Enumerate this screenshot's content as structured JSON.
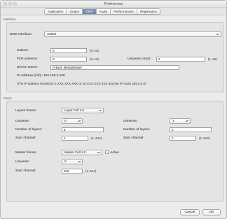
{
  "window": {
    "title": "Preferences"
  },
  "tabs": [
    {
      "label": "Application"
    },
    {
      "label": "Output"
    },
    {
      "label": "DMX",
      "active": true
    },
    {
      "label": "Audio"
    },
    {
      "label": "Performances"
    },
    {
      "label": "Registration"
    }
  ],
  "interface": {
    "section_label": "Interface",
    "dmx_interface_label": "DMX Interface:",
    "dmx_interface_value": "ArtNet",
    "subnet_label": "Subnet:",
    "subnet_value": "0",
    "subnet_range": "(0–15)",
    "first_universe_label": "First universe:",
    "first_universe_value": "0",
    "first_universe_range": "(0–15)",
    "universe_count_label": "Universe count:",
    "universe_count_value": "2",
    "universe_count_range": "(1–16)",
    "device_name_label": "Device Name:",
    "device_name_value": "Arkaos MediaMaster",
    "ip_info": "IP Address (info):  192.168.0.100",
    "ip_note": "(The IP address should be 2.XXX.XXX.XXX or 10.XXX.XXX.XXX and the IP mask 255.0.0.0)"
  },
  "patch": {
    "section_label": "Patch",
    "layers_fixture_label": "Layers fixture:",
    "layers_fixture_value": "Layer Full 1.0",
    "universe_left_label": "Universe:",
    "universe_left_value": "0",
    "universe_right_label": "Universe:",
    "universe_right_value": "1",
    "num_layers_left_label": "Number of layers:",
    "num_layers_left_value": "8",
    "num_layers_right_label": "Number of layers:",
    "num_layers_right_value": "4",
    "start_channel_left_label": "Start channel:",
    "start_channel_left_value": "1",
    "start_channel_left_range": "(1–512)",
    "start_channel_right_label": "Start channel:",
    "start_channel_right_value": "1",
    "start_channel_right_range": "(1–512)",
    "master_fixture_label": "Master fixture:",
    "master_fixture_value": "Master Full 1.0",
    "active_label": "Active",
    "master_universe_label": "Universe:",
    "master_universe_value": "0",
    "master_start_channel_label": "Start channel:",
    "master_start_channel_value": "450",
    "master_start_channel_range": "(1–512)"
  },
  "buttons": {
    "cancel": "Cancel",
    "ok": "OK"
  },
  "colors": {
    "active_tab": "#7089ad",
    "window_bg": "#ececec",
    "group_bg": "#e4e4e4"
  },
  "icons": {
    "select": "chevron-updown-icon",
    "traffic": "window-control-icon"
  }
}
